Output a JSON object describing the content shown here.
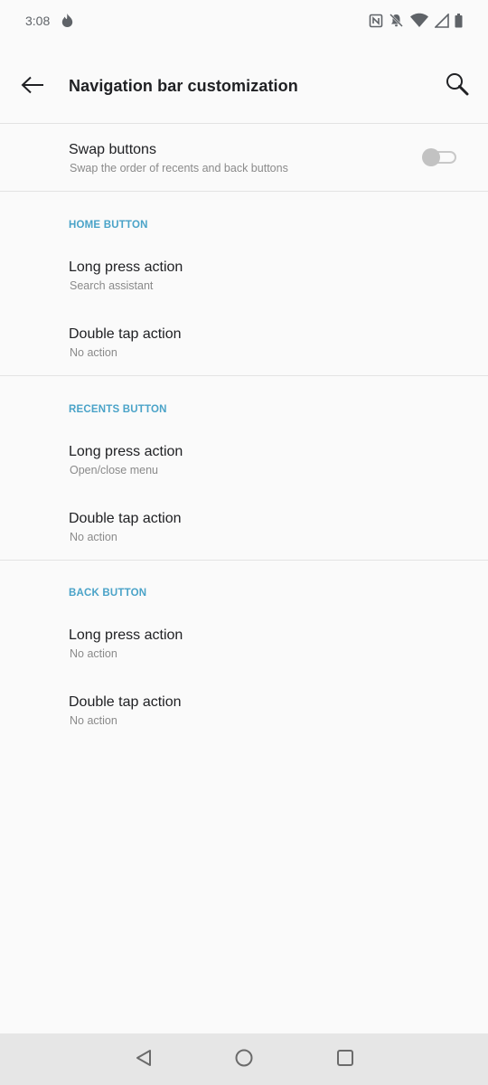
{
  "status_bar": {
    "time": "3:08",
    "app_icon": "fire-icon",
    "icons": [
      "nfc-icon",
      "bell-off-icon",
      "wifi-icon",
      "cellular-signal-icon",
      "battery-icon"
    ]
  },
  "toolbar": {
    "back_icon": "arrow-back-icon",
    "title": "Navigation bar customization",
    "search_icon": "search-icon"
  },
  "swap": {
    "title": "Swap buttons",
    "summary": "Swap the order of recents and back buttons",
    "enabled": false
  },
  "sections": [
    {
      "header": "HOME BUTTON",
      "items": [
        {
          "title": "Long press action",
          "summary": "Search assistant"
        },
        {
          "title": "Double tap action",
          "summary": "No action"
        }
      ]
    },
    {
      "header": "RECENTS BUTTON",
      "items": [
        {
          "title": "Long press action",
          "summary": "Open/close menu"
        },
        {
          "title": "Double tap action",
          "summary": "No action"
        }
      ]
    },
    {
      "header": "BACK BUTTON",
      "items": [
        {
          "title": "Long press action",
          "summary": "No action"
        },
        {
          "title": "Double tap action",
          "summary": "No action"
        }
      ]
    }
  ],
  "nav_bar": {
    "back": "triangle-back-icon",
    "home": "circle-home-icon",
    "recents": "square-recents-icon"
  },
  "colors": {
    "accent": "#4aa3c8",
    "background": "#fafafa",
    "nav_bar": "#e6e6e6"
  }
}
